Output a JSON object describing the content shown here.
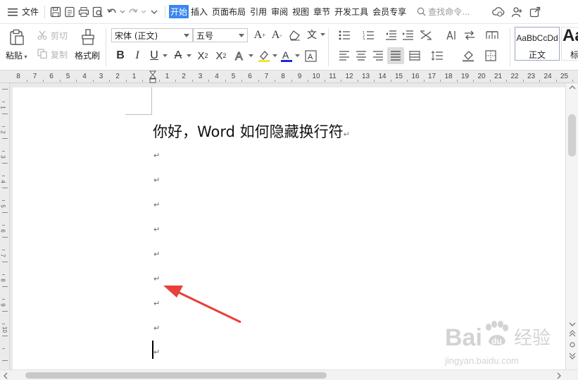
{
  "menubar": {
    "file_label": "文件",
    "tabs": [
      "开始",
      "插入",
      "页面布局",
      "引用",
      "审阅",
      "视图",
      "章节",
      "开发工具",
      "会员专享"
    ],
    "search_placeholder": "查找命令..."
  },
  "ribbon": {
    "paste_label": "粘贴",
    "cut_label": "剪切",
    "copy_label": "复制",
    "format_painter_label": "格式刷",
    "font_name": "宋体 (正文)",
    "font_size": "五号",
    "style_preview": "AaBbCcDd",
    "style_name": "正文",
    "style2_preview": "Aa",
    "style2_name": "标"
  },
  "ruler": {
    "ticks": [
      "8",
      "7",
      "6",
      "5",
      "4",
      "3",
      "2",
      "1",
      "",
      "1",
      "2",
      "3",
      "4",
      "5",
      "6",
      "7",
      "8",
      "9",
      "10",
      "11",
      "12",
      "13",
      "14",
      "15",
      "16",
      "17",
      "18",
      "19",
      "20",
      "21",
      "22",
      "23",
      "24",
      "25"
    ],
    "vticks": [
      "1",
      "2",
      "3",
      "4",
      "5",
      "6",
      "7",
      "8",
      "9",
      "10"
    ]
  },
  "document": {
    "title": "你好，Word 如何隐藏换行符",
    "paragraph_mark": "↵",
    "empty_paragraphs": 9
  },
  "watermark": {
    "brand": "Bai  经验",
    "domain": "jingyan.baidu.com"
  },
  "colors": {
    "accent": "#3a86f0",
    "arrow": "#e8403a",
    "font_color": "#1a2bd6"
  }
}
